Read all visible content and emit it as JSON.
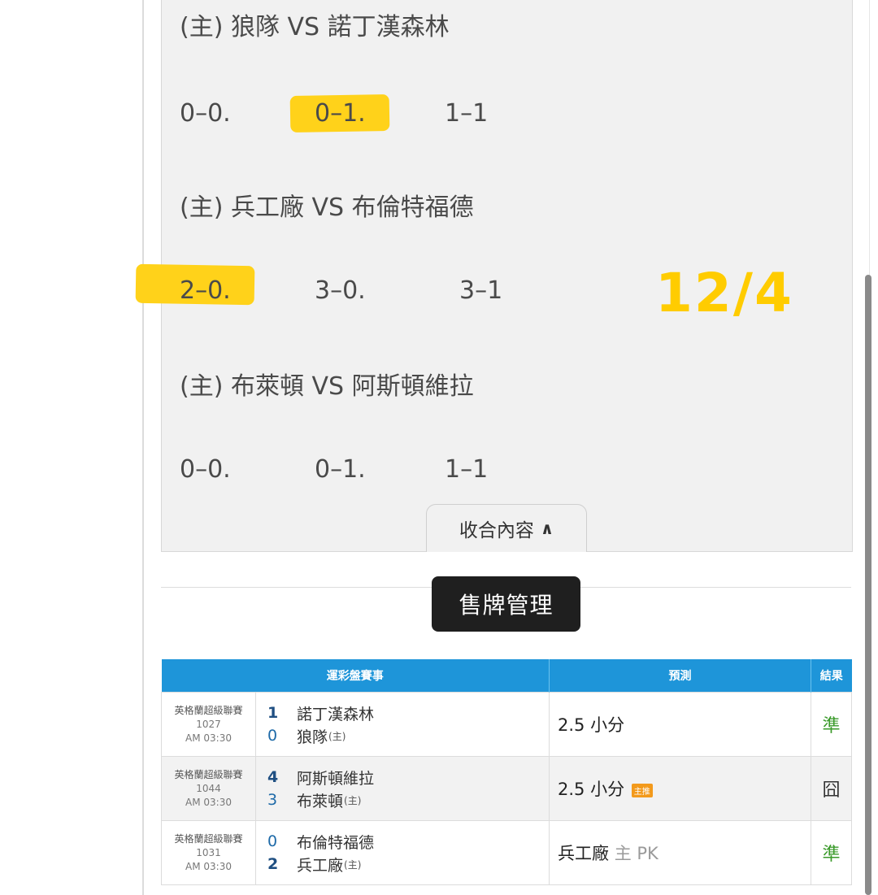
{
  "predictions": {
    "matches": [
      {
        "title": "(主) 狼隊 VS 諾丁漢森林",
        "scores": [
          "0–0.",
          "0–1.",
          "1–1"
        ],
        "highlight": 1
      },
      {
        "title": "(主) 兵工廠 VS 布倫特福德",
        "scores": [
          "2–0.",
          "3–0.",
          "3–1"
        ],
        "highlight": 0
      },
      {
        "title": "(主) 布萊頓 VS 阿斯頓維拉",
        "scores": [
          "0–0.",
          "0–1.",
          "1–1"
        ],
        "highlight": -1
      }
    ],
    "date_mark": "12/4",
    "collapse_label": "收合內容",
    "highlight_color": "#ffd21a"
  },
  "tooltip": {
    "label": "售牌管理"
  },
  "table": {
    "headers": {
      "game": "運彩盤賽事",
      "prediction": "預測",
      "result": "結果"
    },
    "rows": [
      {
        "league": "英格蘭超級聯賽",
        "code": "1027",
        "time": "AM 03:30",
        "team1": {
          "score": "1",
          "name": "諾丁漢森林"
        },
        "team2": {
          "score": "0",
          "name": "狼隊",
          "home_tag": "(主)"
        },
        "prediction": "2.5 小分",
        "badge": "",
        "result": "準"
      },
      {
        "league": "英格蘭超級聯賽",
        "code": "1044",
        "time": "AM 03:30",
        "team1": {
          "score": "4",
          "name": "阿斯頓維拉"
        },
        "team2": {
          "score": "3",
          "name": "布萊頓",
          "home_tag": "(主)"
        },
        "prediction": "2.5 小分",
        "badge": "主推",
        "result": "囧"
      },
      {
        "league": "英格蘭超級聯賽",
        "code": "1031",
        "time": "AM 03:30",
        "team1": {
          "score": "0",
          "name": "布倫特福德"
        },
        "team2": {
          "score": "2",
          "name": "兵工廠",
          "home_tag": "(主)"
        },
        "prediction": "兵工廠",
        "prediction_suffix": "主 PK",
        "badge": "",
        "result": "準"
      }
    ]
  },
  "colors": {
    "header_blue": "#1e95d9",
    "good": "#3a9a2a",
    "accent_yellow": "#ffcc00"
  }
}
